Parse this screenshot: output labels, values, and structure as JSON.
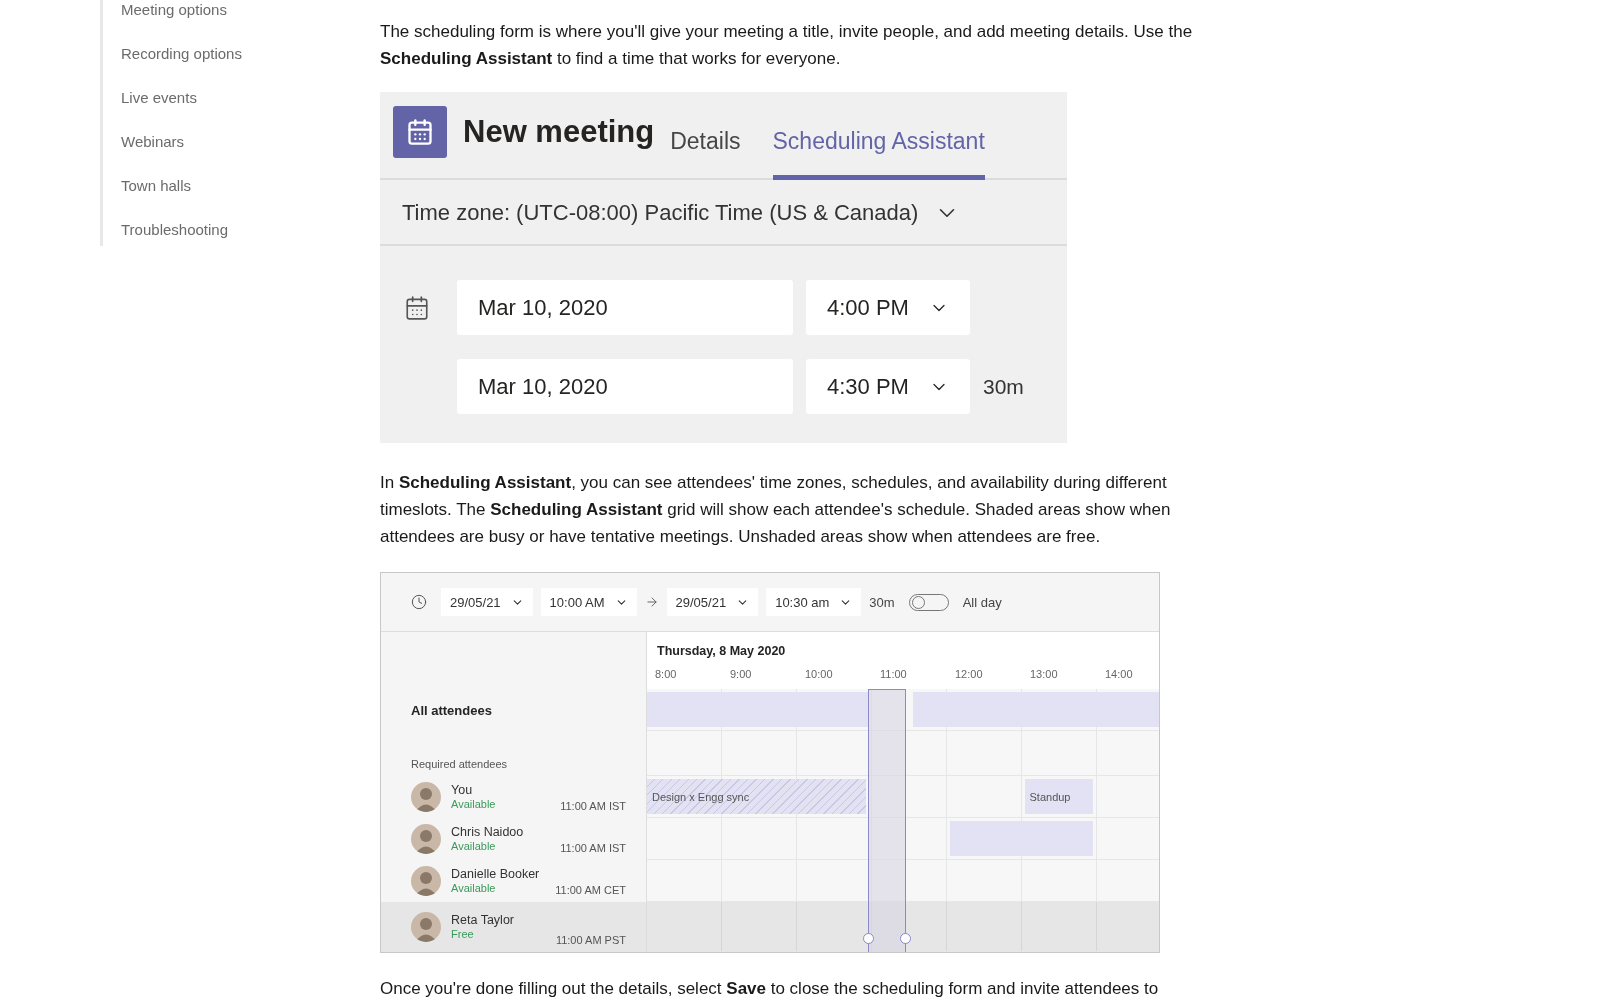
{
  "sidebar": {
    "items": [
      "Meeting options",
      "Recording options",
      "Live events",
      "Webinars",
      "Town halls",
      "Troubleshooting"
    ]
  },
  "intro": "The scheduling form is where you'll give your meeting a title, invite people, and add meeting details. Use the **Scheduling Assistant** to find a time that works for everyone.",
  "new_meeting": {
    "title": "New meeting",
    "tabs": [
      {
        "label": "Details",
        "selected": false
      },
      {
        "label": "Scheduling Assistant",
        "selected": true
      }
    ],
    "time_zone": "Time zone: (UTC-08:00) Pacific Time (US & Canada)",
    "start": {
      "date": "Mar 10, 2020",
      "time": "4:00 PM"
    },
    "end": {
      "date": "Mar 10, 2020",
      "time": "4:30 PM",
      "duration": "30m"
    }
  },
  "assistant_paragraph": "In **Scheduling Assistant**, you can see attendees' time zones, schedules, and availability during different timeslots. The **Scheduling Assistant** grid will show each attendee's schedule. Shaded areas show when attendees are busy or have tentative meetings. Unshaded areas show when attendees are free.",
  "scheduling_assistant": {
    "toolbar": {
      "start_date": "29/05/21",
      "start_time": "10:00 AM",
      "end_date": "29/05/21",
      "end_time": "10:30 am",
      "duration": "30m",
      "all_day": {
        "label": "All day",
        "on": false
      }
    },
    "day": "Thursday, 8 May 2020",
    "hours": [
      "8:00",
      "9:00",
      "10:00",
      "11:00",
      "12:00",
      "13:00",
      "14:00"
    ],
    "all_attendees": {
      "label": "All attendees",
      "events": [
        {
          "kind": "busy"
        },
        {
          "kind": "busy"
        }
      ]
    },
    "group_label": "Required attendees",
    "attendees": [
      {
        "name": "You",
        "status": "Available",
        "local_time": "11:00 AM IST",
        "selected": false,
        "events": [
          {
            "kind": "tentative",
            "title": "Design x Engg sync"
          },
          {
            "kind": "busy",
            "title": "Standup"
          }
        ]
      },
      {
        "name": "Chris Naidoo",
        "status": "Available",
        "local_time": "11:00 AM IST",
        "selected": false,
        "events": [
          {
            "kind": "busy"
          }
        ]
      },
      {
        "name": "Danielle Booker",
        "status": "Available",
        "local_time": "11:00 AM CET",
        "selected": false
      },
      {
        "name": "Reta Taylor",
        "status": "Free",
        "local_time": "11:00 AM PST",
        "selected": true
      }
    ]
  },
  "closing": "Once you're done filling out the details, select **Save** to close the scheduling form and invite attendees to"
}
